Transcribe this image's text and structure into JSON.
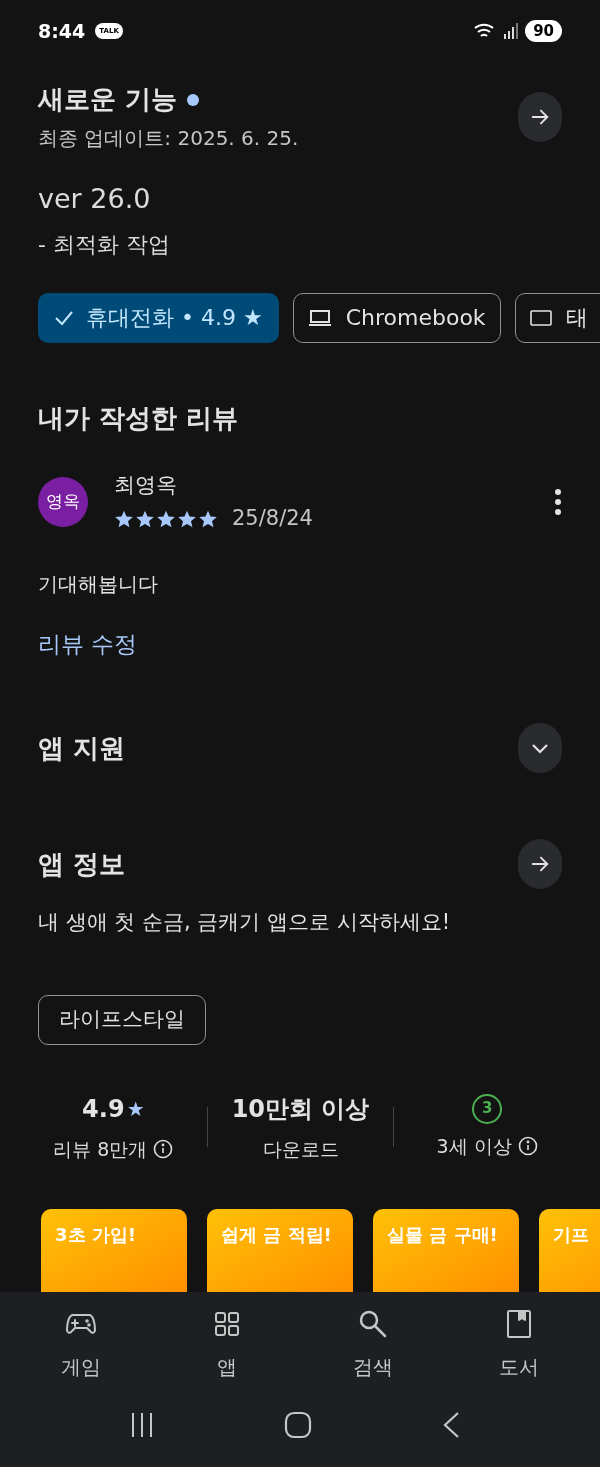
{
  "status_bar": {
    "time": "8:44",
    "notification": "TALK",
    "battery": "90"
  },
  "whats_new": {
    "title": "새로운 기능",
    "unread": true,
    "updated": "최종 업데이트: 2025. 6. 25.",
    "version": "ver 26.0",
    "notes": "- 최적화 작업"
  },
  "device_chips": [
    {
      "kind": "phone",
      "label": "휴대전화 • 4.9",
      "star": "★",
      "selected": true
    },
    {
      "kind": "laptop",
      "label": "Chromebook",
      "selected": false
    },
    {
      "kind": "tablet",
      "label": "태",
      "selected": false
    }
  ],
  "my_review": {
    "heading": "내가 작성한 리뷰",
    "avatar": "영옥",
    "author": "최영옥",
    "stars": 5,
    "date": "25/8/24",
    "text": "기대해봅니다",
    "edit_link": "리뷰 수정"
  },
  "app_support": {
    "title": "앱 지원",
    "expanded": false
  },
  "app_info": {
    "title": "앱 정보",
    "description": "내 생애 첫 순금, 금캐기 앱으로 시작하세요!",
    "category": "라이프스타일"
  },
  "stats": [
    {
      "kind": "rating",
      "value": "4.9",
      "star": "★",
      "label": "리뷰 8만개"
    },
    {
      "kind": "downloads",
      "value": "10만회 이상",
      "label": "다운로드"
    },
    {
      "kind": "age",
      "value": "3",
      "label": "3세 이상"
    }
  ],
  "screenshots": [
    {
      "title": "3초 가입!"
    },
    {
      "title": "쉽게 금 적립!"
    },
    {
      "title": "실물 금 구매!"
    },
    {
      "title": "기프"
    }
  ],
  "bottom_nav": [
    {
      "kind": "games",
      "label": "게임",
      "selected": false
    },
    {
      "kind": "apps",
      "label": "앱",
      "selected": false
    },
    {
      "kind": "search",
      "label": "검색",
      "selected": false
    },
    {
      "kind": "books",
      "label": "도서",
      "selected": false
    }
  ]
}
